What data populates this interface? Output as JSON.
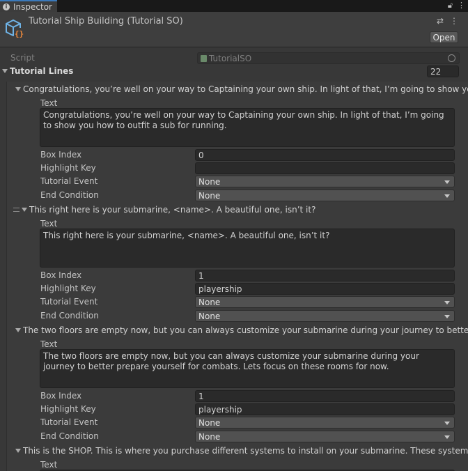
{
  "tab": {
    "icon": "info-icon",
    "label": "Inspector",
    "lock_icon": "lock-icon",
    "menu_icon": "kebab-menu-icon"
  },
  "header": {
    "object_icon": "scriptable-object-icon",
    "title": "Tutorial Ship Building (Tutorial SO)",
    "settings_icon": "preset-settings-icon",
    "menu_icon": "kebab-menu-icon",
    "open_label": "Open"
  },
  "script": {
    "label": "Script",
    "value": "TutorialSO",
    "file_icon": "script-file-icon",
    "target_icon": "object-picker-icon"
  },
  "tutorial_lines": {
    "label": "Tutorial Lines",
    "count": "22",
    "field_labels": {
      "text": "Text",
      "box_index": "Box Index",
      "highlight_key": "Highlight Key",
      "tutorial_event": "Tutorial Event",
      "end_condition": "End Condition"
    },
    "items": [
      {
        "header": "Congratulations, you’re well on your way to Captaining your own ship. In light of that, I’m going to show you how to outfit a sub for running.",
        "text": "Congratulations, you’re well on your way to Captaining your own ship. In light of that, I’m going to show you how to outfit a sub for running.",
        "box_index": "0",
        "highlight_key": "",
        "tutorial_event": "None",
        "end_condition": "None"
      },
      {
        "header": "This right here is your submarine, <name>. A beautiful one, isn’t it?",
        "text": "This right here is your submarine, <name>. A beautiful one, isn’t it?",
        "box_index": "1",
        "highlight_key": "playership",
        "tutorial_event": "None",
        "end_condition": "None"
      },
      {
        "header": "The two floors are empty now, but you can always customize your submarine during your journey to better prepare yourself for combats. Lets focus on these rooms for now.",
        "text": "The two floors are empty now, but you can always customize your submarine during your journey to better prepare yourself for combats. Lets focus on these rooms for now.",
        "box_index": "1",
        "highlight_key": "playership",
        "tutorial_event": "None",
        "end_condition": "None"
      },
      {
        "header": "This is the SHOP. This is where you purchase different systems to install on your submarine. These systems may m",
        "text": "",
        "box_index": "",
        "highlight_key": "",
        "tutorial_event": "",
        "end_condition": ""
      }
    ]
  }
}
